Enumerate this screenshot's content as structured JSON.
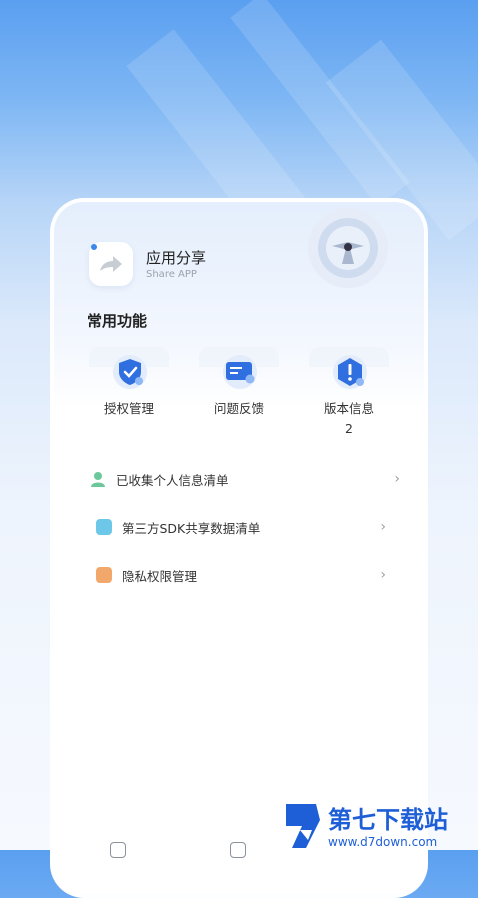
{
  "app": {
    "title": "应用分享",
    "subtitle": "Share APP"
  },
  "section": {
    "title": "常用功能"
  },
  "tiles": [
    {
      "label": "授权管理",
      "icon": "shield-check-icon"
    },
    {
      "label": "问题反馈",
      "icon": "feedback-card-icon"
    },
    {
      "label": "版本信息\n2",
      "icon": "info-hexagon-icon"
    }
  ],
  "list": [
    {
      "label": "已收集个人信息清单",
      "icon": "person-icon",
      "color": "#6cc79a"
    },
    {
      "label": "第三方SDK共享数据清单",
      "icon": "sdk-box-icon",
      "color": "#6cc7e8"
    },
    {
      "label": "隐私权限管理",
      "icon": "privacy-box-icon",
      "color": "#f2a86a"
    }
  ],
  "watermark": {
    "name": "第七下载站",
    "url": "www.d7down.com"
  },
  "colors": {
    "accent": "#3b86f0"
  }
}
